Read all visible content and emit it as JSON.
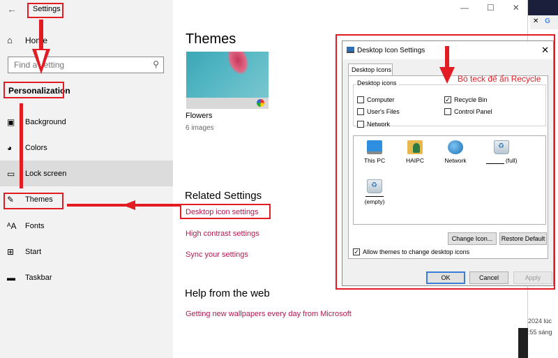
{
  "sidebar": {
    "title": "Settings",
    "home_label": "Home",
    "search_placeholder": "Find a setting",
    "section": "Personalization",
    "items": [
      {
        "label": "Background",
        "icon": "picture-icon"
      },
      {
        "label": "Colors",
        "icon": "palette-icon"
      },
      {
        "label": "Lock screen",
        "icon": "lock-screen-icon"
      },
      {
        "label": "Themes",
        "icon": "themes-icon"
      },
      {
        "label": "Fonts",
        "icon": "fonts-icon"
      },
      {
        "label": "Start",
        "icon": "start-icon"
      },
      {
        "label": "Taskbar",
        "icon": "taskbar-icon"
      }
    ]
  },
  "main": {
    "heading": "Themes",
    "theme": {
      "name": "Flowers",
      "count": "6 images"
    },
    "related_heading": "Related Settings",
    "related_links": [
      "Desktop icon settings",
      "High contrast settings",
      "Sync your settings"
    ],
    "help_heading": "Help from the web",
    "help_link": "Getting new wallpapers every day from Microsoft"
  },
  "dialog": {
    "title": "Desktop Icon Settings",
    "tab": "Desktop Icons",
    "group_label": "Desktop icons",
    "checkboxes": [
      {
        "label": "Computer",
        "checked": false
      },
      {
        "label": "Recycle Bin",
        "checked": true
      },
      {
        "label": "User's Files",
        "checked": false
      },
      {
        "label": "Control Panel",
        "checked": false
      },
      {
        "label": "Network",
        "checked": false
      }
    ],
    "icons": [
      {
        "label": "This PC"
      },
      {
        "label": "HAIPC"
      },
      {
        "label": "Network"
      },
      {
        "label": "(full)"
      },
      {
        "label": "(empty)"
      }
    ],
    "change_icon": "Change Icon...",
    "restore_default": "Restore Default",
    "allow_themes": "Allow themes to change desktop icons",
    "ok": "OK",
    "cancel": "Cancel",
    "apply": "Apply"
  },
  "annotation": "Bỏ teck để ẩn Recycle",
  "browser_peek": {
    "line1": "2024 lúc",
    "line2": ":55 sáng"
  },
  "colors": {
    "accent_link": "#b3174f",
    "annotation_red": "#e31c23",
    "primary_button_border": "#3a7dd8"
  }
}
